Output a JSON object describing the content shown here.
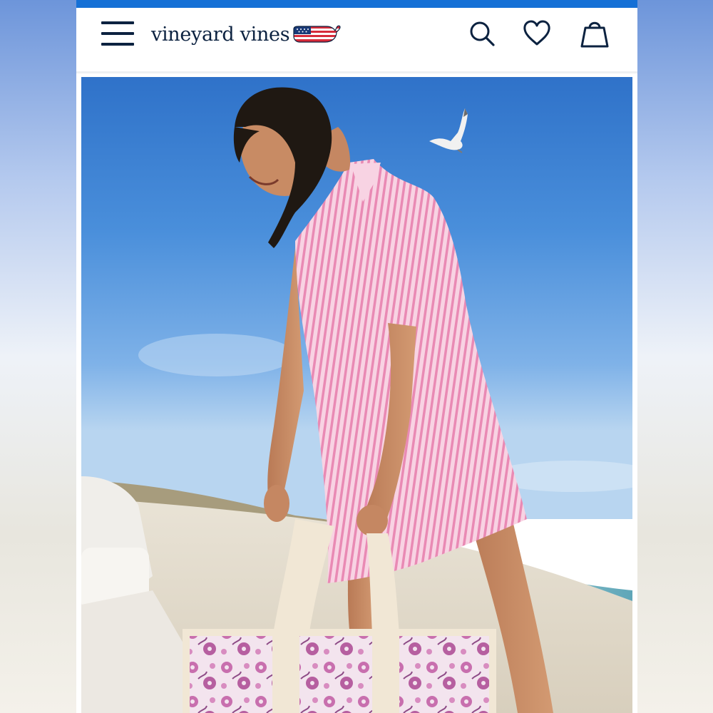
{
  "brand": {
    "name": "vineyard vines",
    "logo_icon": "whale-flag-icon"
  },
  "header": {
    "menu_icon": "hamburger-menu-icon",
    "search_icon": "search-icon",
    "wishlist_icon": "heart-icon",
    "bag_icon": "shopping-bag-icon"
  },
  "colors": {
    "top_strip": "#1570d6",
    "navy": "#0c2240",
    "sky": "#3f86d8",
    "shirt_pink": "#f3b4cf"
  },
  "hero": {
    "image": "woman-in-pink-striped-shirt-dress-on-beach-with-floral-tote"
  }
}
